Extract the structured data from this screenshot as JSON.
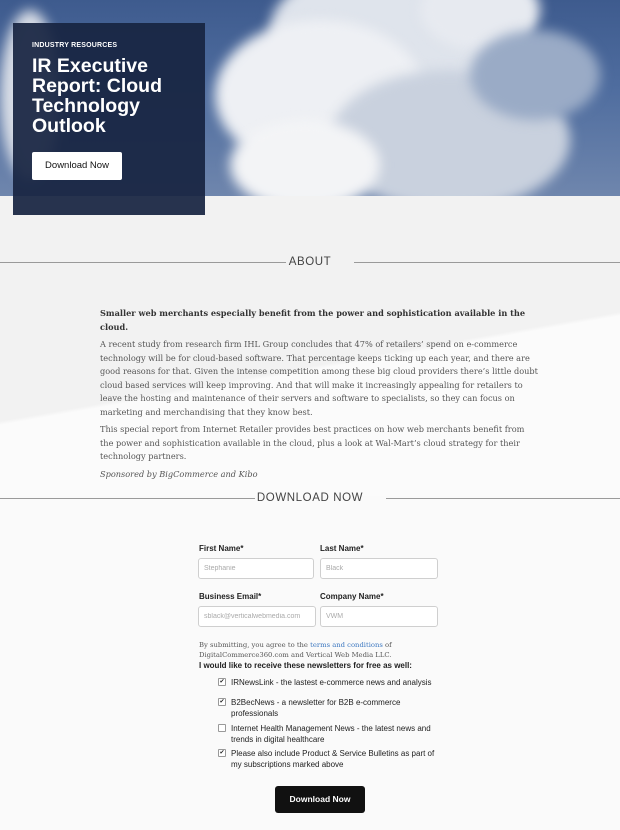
{
  "hero": {
    "eyebrow": "INDUSTRY RESOURCES",
    "title": "IR Executive Report: Cloud Technology Outlook",
    "button_label": "Download Now"
  },
  "about": {
    "heading": "ABOUT",
    "lead": "Smaller web merchants especially benefit from the power and sophistication available in the cloud.",
    "paragraph1": "A recent study from research firm IHL Group concludes that 47% of retailers’ spend on e-commerce technology will be for cloud-based software. That percentage keeps ticking up each year, and there are good reasons for that. Given the intense competition among these big cloud providers there’s little doubt cloud based services will keep improving. And that will make it increasingly appealing for retailers to leave the hosting and maintenance of their servers and software to specialists, so they can focus on marketing and merchandising that they know best.",
    "paragraph2": "This special report from Internet Retailer provides best practices on how web merchants benefit from the power and sophistication available in the cloud, plus a look at Wal-Mart’s cloud strategy for their technology partners.",
    "sponsor": "Sponsored by BigCommerce and Kibo"
  },
  "download": {
    "heading": "DOWNLOAD NOW"
  },
  "form": {
    "first_name": {
      "label": "First Name*",
      "placeholder": "Stephanie"
    },
    "last_name": {
      "label": "Last Name*",
      "placeholder": "Black"
    },
    "email": {
      "label": "Business Email*",
      "placeholder": "sblack@verticalwebmedia.com"
    },
    "company": {
      "label": "Company Name*",
      "placeholder": "VWM"
    },
    "consent_before": "By submitting, you agree to the ",
    "consent_link": "terms and conditions",
    "consent_after": " of DigitalCommerce360.com and Vertical Web Media LLC.",
    "newsletter_heading": "I would like to receive these newsletters for free as well:",
    "newsletters": [
      {
        "label": "IRNewsLink - the lastest e-commerce news and analysis",
        "checked": true,
        "mark": "✔"
      },
      {
        "label": "B2BecNews - a newsletter for B2B e-commerce professionals",
        "checked": true,
        "mark": "✔"
      },
      {
        "label": "Internet Health Management News - the latest news and trends in digital healthcare",
        "checked": false,
        "mark": ""
      },
      {
        "label": "Please also include Product & Service Bulletins as part of my subscriptions marked above",
        "checked": true,
        "mark": "✔"
      }
    ],
    "submit_label": "Download Now"
  }
}
